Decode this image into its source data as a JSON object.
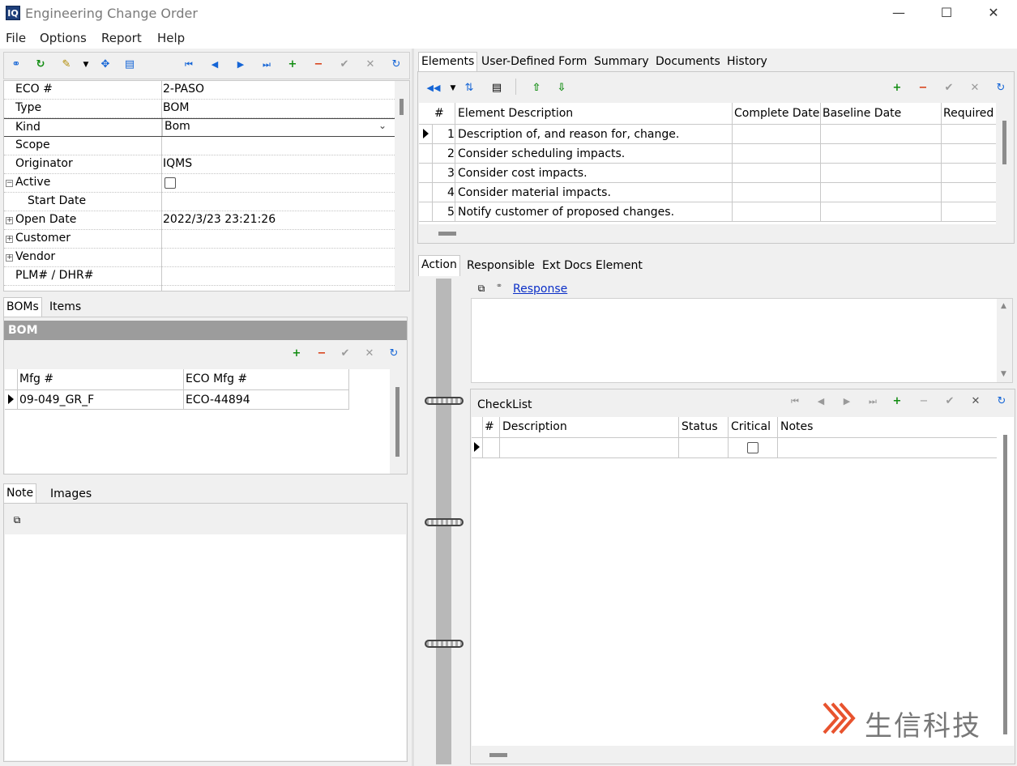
{
  "window": {
    "app_icon": "IQ",
    "title": "Engineering Change Order",
    "minimize": "—",
    "maximize": "☐",
    "close": "✕"
  },
  "menu": [
    "File",
    "Options",
    "Report",
    "Help"
  ],
  "left_toolbar_icons": [
    "binoculars-icon",
    "refresh-icon",
    "wand-icon",
    "dropdown-icon",
    "move-icon",
    "form-icon",
    "first-icon",
    "prev-icon",
    "next-icon",
    "last-icon",
    "add-icon",
    "delete-icon",
    "post-icon",
    "cancel-icon",
    "refresh-icon"
  ],
  "properties": [
    {
      "label": "ECO #",
      "value": "2-PASO",
      "indent": 0,
      "expander": ""
    },
    {
      "label": "Type",
      "value": "BOM",
      "indent": 0,
      "expander": ""
    },
    {
      "label": "Kind",
      "value": "Bom",
      "indent": 0,
      "expander": "",
      "dropdown": true
    },
    {
      "label": "Scope",
      "value": "",
      "indent": 0,
      "expander": ""
    },
    {
      "label": "Originator",
      "value": "IQMS",
      "indent": 0,
      "expander": ""
    },
    {
      "label": "Active",
      "value": "",
      "indent": 0,
      "expander": "−",
      "checkbox": true
    },
    {
      "label": "Start Date",
      "value": "",
      "indent": 1,
      "expander": ""
    },
    {
      "label": "Open Date",
      "value": "2022/3/23 23:21:26",
      "indent": 0,
      "expander": "+"
    },
    {
      "label": "Customer",
      "value": "",
      "indent": 0,
      "expander": "+"
    },
    {
      "label": "Vendor",
      "value": "",
      "indent": 0,
      "expander": "+"
    },
    {
      "label": "PLM# / DHR#",
      "value": "",
      "indent": 0,
      "expander": ""
    }
  ],
  "bom_tabs": [
    "BOMs",
    "Items"
  ],
  "bom": {
    "header": "BOM",
    "columns": [
      "Mfg #",
      "ECO Mfg #"
    ],
    "rows": [
      [
        "09-049_GR_F",
        "ECO-44894"
      ]
    ]
  },
  "note_tabs": [
    "Note",
    "Images"
  ],
  "elements_tabs": [
    "Elements",
    "User-Defined Form",
    "Summary",
    "Documents",
    "History"
  ],
  "elements": {
    "columns": [
      "#",
      "Element Description",
      "Complete Date",
      "Baseline Date",
      "Required"
    ],
    "rows": [
      [
        "1",
        "Description of, and reason for, change."
      ],
      [
        "2",
        "Consider scheduling impacts."
      ],
      [
        "3",
        "Consider cost impacts."
      ],
      [
        "4",
        "Consider material impacts."
      ],
      [
        "5",
        "Notify customer of proposed changes."
      ]
    ]
  },
  "action_tabs": [
    "Action",
    "Responsible",
    "Ext Docs Element"
  ],
  "response_link": "Response",
  "checklist": {
    "title": "CheckList",
    "columns": [
      "#",
      "Description",
      "Status",
      "Critical",
      "Notes"
    ]
  },
  "watermark": "生信科技",
  "colors": {
    "accent_blue": "#1565d6",
    "add_green": "#118c11",
    "delete_red": "#d63a10",
    "header_gray": "#9c9c9c"
  }
}
